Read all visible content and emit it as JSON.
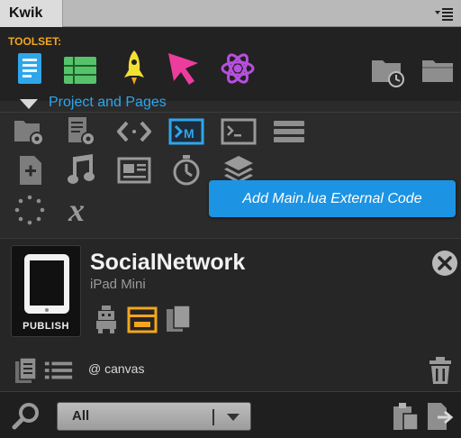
{
  "window": {
    "title": "Kwik"
  },
  "toolset": {
    "label": "TOOLSET:"
  },
  "section": {
    "title": "Project and Pages"
  },
  "tooltip": {
    "text": "Add Main.lua External Code"
  },
  "project": {
    "name": "SocialNetwork",
    "device": "iPad Mini",
    "publish_label": "PUBLISH",
    "canvas_label": "@ canvas"
  },
  "filter": {
    "selected": "All"
  },
  "colors": {
    "accent_orange": "#f2a61f",
    "accent_blue": "#2fa6ea",
    "tooltip_bg": "#1d93e3",
    "pink_cursor": "#ec3d9c",
    "green_grid": "#56c36b",
    "yellow_rocket": "#f3e034",
    "purple_atom": "#b84fe0"
  },
  "icons": {
    "toolset": [
      "document-icon",
      "grid-list-icon",
      "rocket-icon",
      "cursor-arrow-icon",
      "atom-icon",
      "folder-clock-icon",
      "folder-icon"
    ],
    "grid_row1": [
      "folder-gear-icon",
      "document-gear-icon",
      "code-brackets-icon",
      "external-code-icon",
      "terminal-icon",
      "stack-icon"
    ],
    "grid_row2": [
      "add-page-icon",
      "music-icon",
      "image-frame-icon",
      "stopwatch-icon",
      "layers-icon"
    ],
    "grid_row3": [
      "dotted-circle-icon",
      "variable-x-icon"
    ]
  }
}
